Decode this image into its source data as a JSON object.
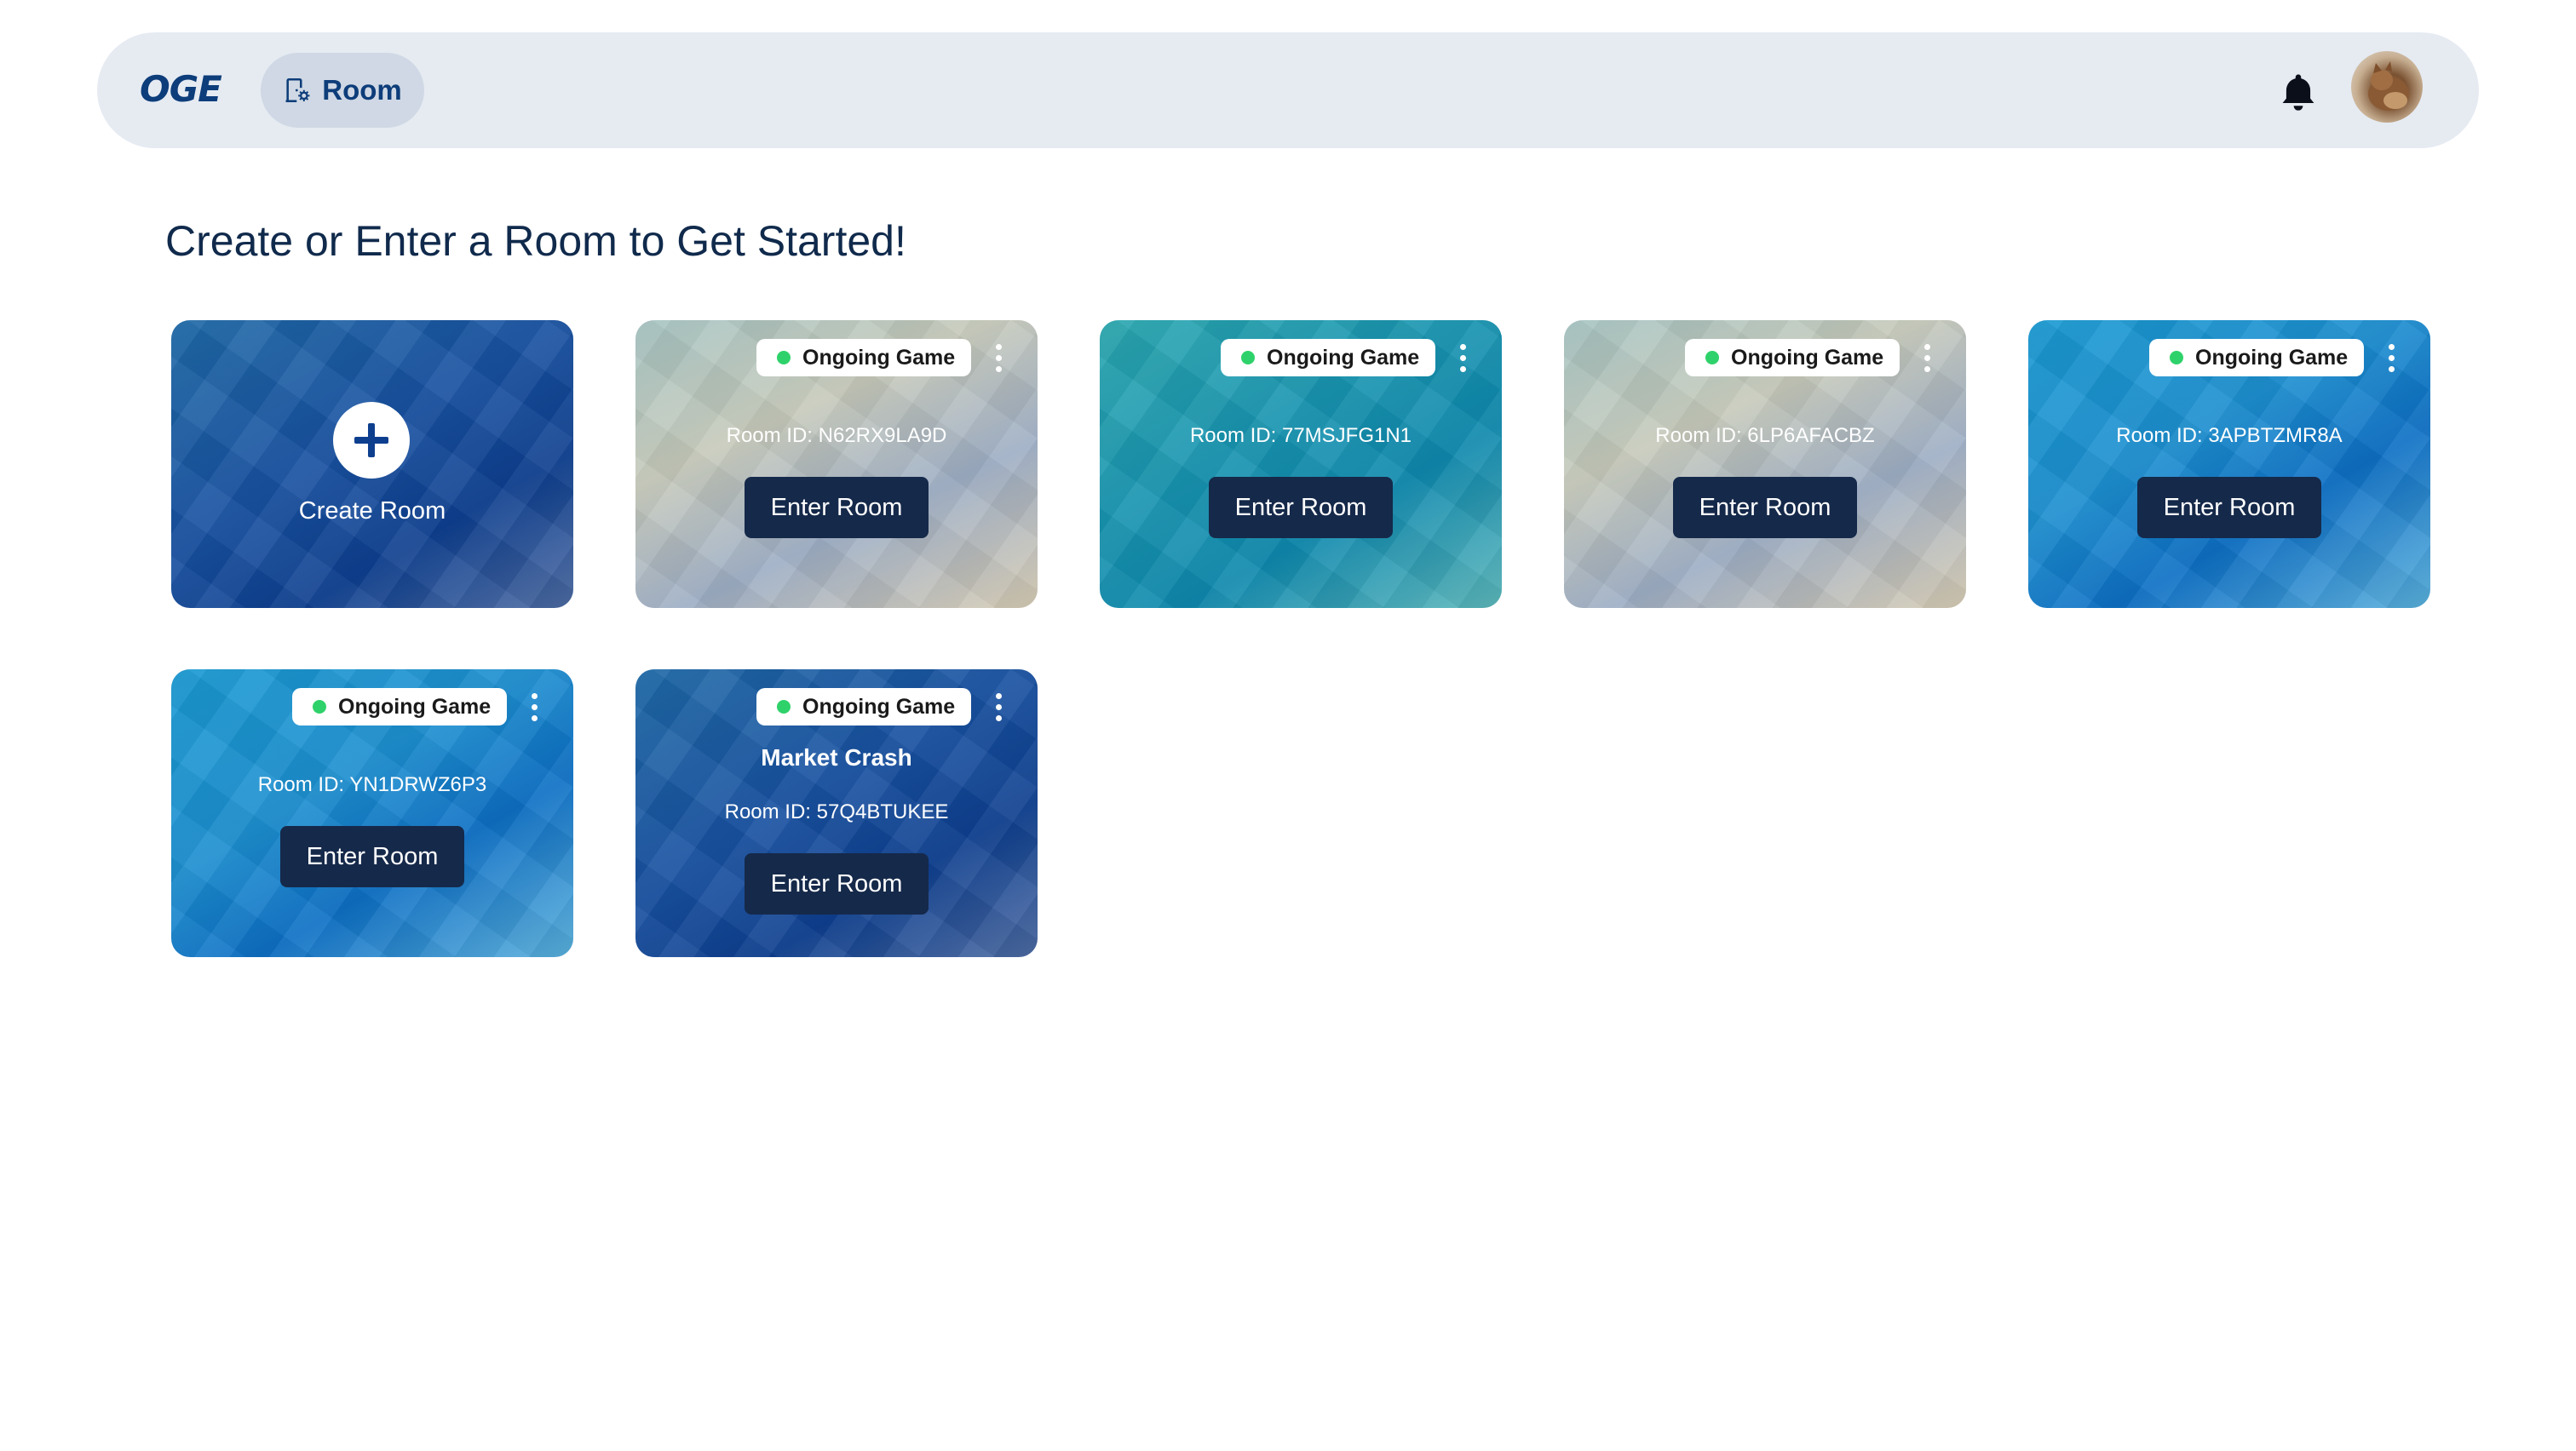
{
  "header": {
    "logo_text": "OGE",
    "room_tab_label": "Room",
    "icons": {
      "room": "door-gear-icon",
      "notifications": "bell-icon",
      "avatar": "user-avatar"
    }
  },
  "page_title": "Create or Enter a Room to Get Started!",
  "create_card": {
    "label": "Create Room",
    "icon": "plus-icon"
  },
  "rooms": [
    {
      "status": "Ongoing Game",
      "name": "",
      "room_id": "Room ID: N62RX9LA9D",
      "button": "Enter Room",
      "theme": "beige"
    },
    {
      "status": "Ongoing Game",
      "name": "",
      "room_id": "Room ID: 77MSJFG1N1",
      "button": "Enter Room",
      "theme": "teal"
    },
    {
      "status": "Ongoing Game",
      "name": "",
      "room_id": "Room ID: 6LP6AFACBZ",
      "button": "Enter Room",
      "theme": "beige"
    },
    {
      "status": "Ongoing Game",
      "name": "",
      "room_id": "Room ID: 3APBTZMR8A",
      "button": "Enter Room",
      "theme": "sky"
    },
    {
      "status": "Ongoing Game",
      "name": "",
      "room_id": "Room ID: YN1DRWZ6P3",
      "button": "Enter Room",
      "theme": "sky"
    },
    {
      "status": "Ongoing Game",
      "name": "Market Crash",
      "room_id": "Room ID: 57Q4BTUKEE",
      "button": "Enter Room",
      "theme": "deepblue"
    }
  ],
  "colors": {
    "topbar_bg": "#e6ebf2",
    "brand": "#0d3d7a",
    "button_bg": "#15294a",
    "status_dot": "#2fd26a"
  }
}
